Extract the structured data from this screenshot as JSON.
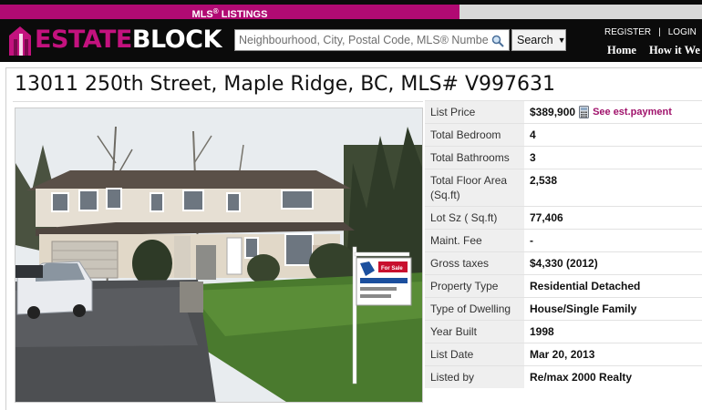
{
  "header": {
    "mls_label": "MLS",
    "mls_sup": "®",
    "mls_suffix": " LISTINGS",
    "logo": {
      "part1": "ESTATE",
      "part2": "BLOCK"
    },
    "search": {
      "placeholder": "Neighbourhood, City, Postal Code, MLS® Numbe",
      "button_label": "Search"
    },
    "auth": {
      "register": "REGISTER",
      "separator": "|",
      "login": "LOGIN"
    },
    "nav": [
      "Home",
      "How it We"
    ]
  },
  "listing": {
    "title": "13011 250th Street, Maple Ridge, BC, MLS# V997631",
    "payment_link": "See est.payment",
    "details": [
      {
        "label": "List Price",
        "value": "$389,900"
      },
      {
        "label": "Total Bedroom",
        "value": "4"
      },
      {
        "label": "Total Bathrooms",
        "value": "3"
      },
      {
        "label": "Total Floor Area (Sq.ft)",
        "value": "2,538"
      },
      {
        "label": "Lot Sz ( Sq.ft)",
        "value": "77,406"
      },
      {
        "label": "Maint. Fee",
        "value": "-"
      },
      {
        "label": "Gross taxes",
        "value": "$4,330 (2012)"
      },
      {
        "label": "Property Type",
        "value": "Residential Detached"
      },
      {
        "label": "Type of Dwelling",
        "value": "House/Single Family"
      },
      {
        "label": "Year Built",
        "value": "1998"
      },
      {
        "label": "List Date",
        "value": "Mar 20, 2013"
      },
      {
        "label": "Listed by",
        "value": "Re/max 2000 Realty"
      }
    ],
    "sign_text": "For Sale"
  },
  "colors": {
    "brand_magenta": "#c3127e",
    "header_black": "#0b0b0b",
    "link_purple": "#a0126b"
  }
}
